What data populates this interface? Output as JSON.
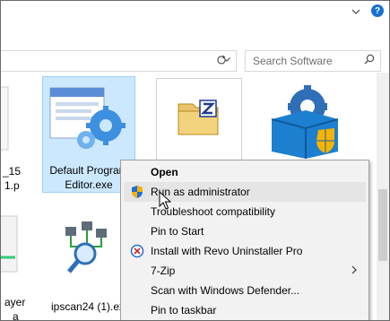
{
  "toolbar": {
    "expand_icon": "chevron-down-icon",
    "help_icon": "help-icon",
    "help_glyph": "?"
  },
  "address": {
    "dropdown_icon": "chevron-down-icon",
    "refresh_icon": "refresh-icon"
  },
  "search": {
    "placeholder": "Search Software"
  },
  "files": {
    "left_partial_1": "_15",
    "left_partial_2": "1.p",
    "left_partial_3": "ayer",
    "left_partial_4": "a",
    "default_programs": {
      "line1": "Default Program",
      "line2": "Editor.exe"
    },
    "ipscan": "ipscan24 (1).ex"
  },
  "context_menu": {
    "items": [
      {
        "label": "Open",
        "bold": true
      },
      {
        "label": "Run as administrator",
        "icon": "shield-icon"
      },
      {
        "label": "Troubleshoot compatibility"
      },
      {
        "label": "Pin to Start"
      },
      {
        "label": "Install with Revo Uninstaller Pro",
        "icon": "revo-icon"
      },
      {
        "label": "7-Zip",
        "submenu": true
      },
      {
        "label": "Scan with Windows Defender..."
      },
      {
        "label": "Pin to taskbar"
      }
    ]
  },
  "colors": {
    "selection": "#cce8ff",
    "menu_bg": "#f2f2f2",
    "menu_hover": "#e5e5e5",
    "accent_blue": "#1a6fd1"
  }
}
